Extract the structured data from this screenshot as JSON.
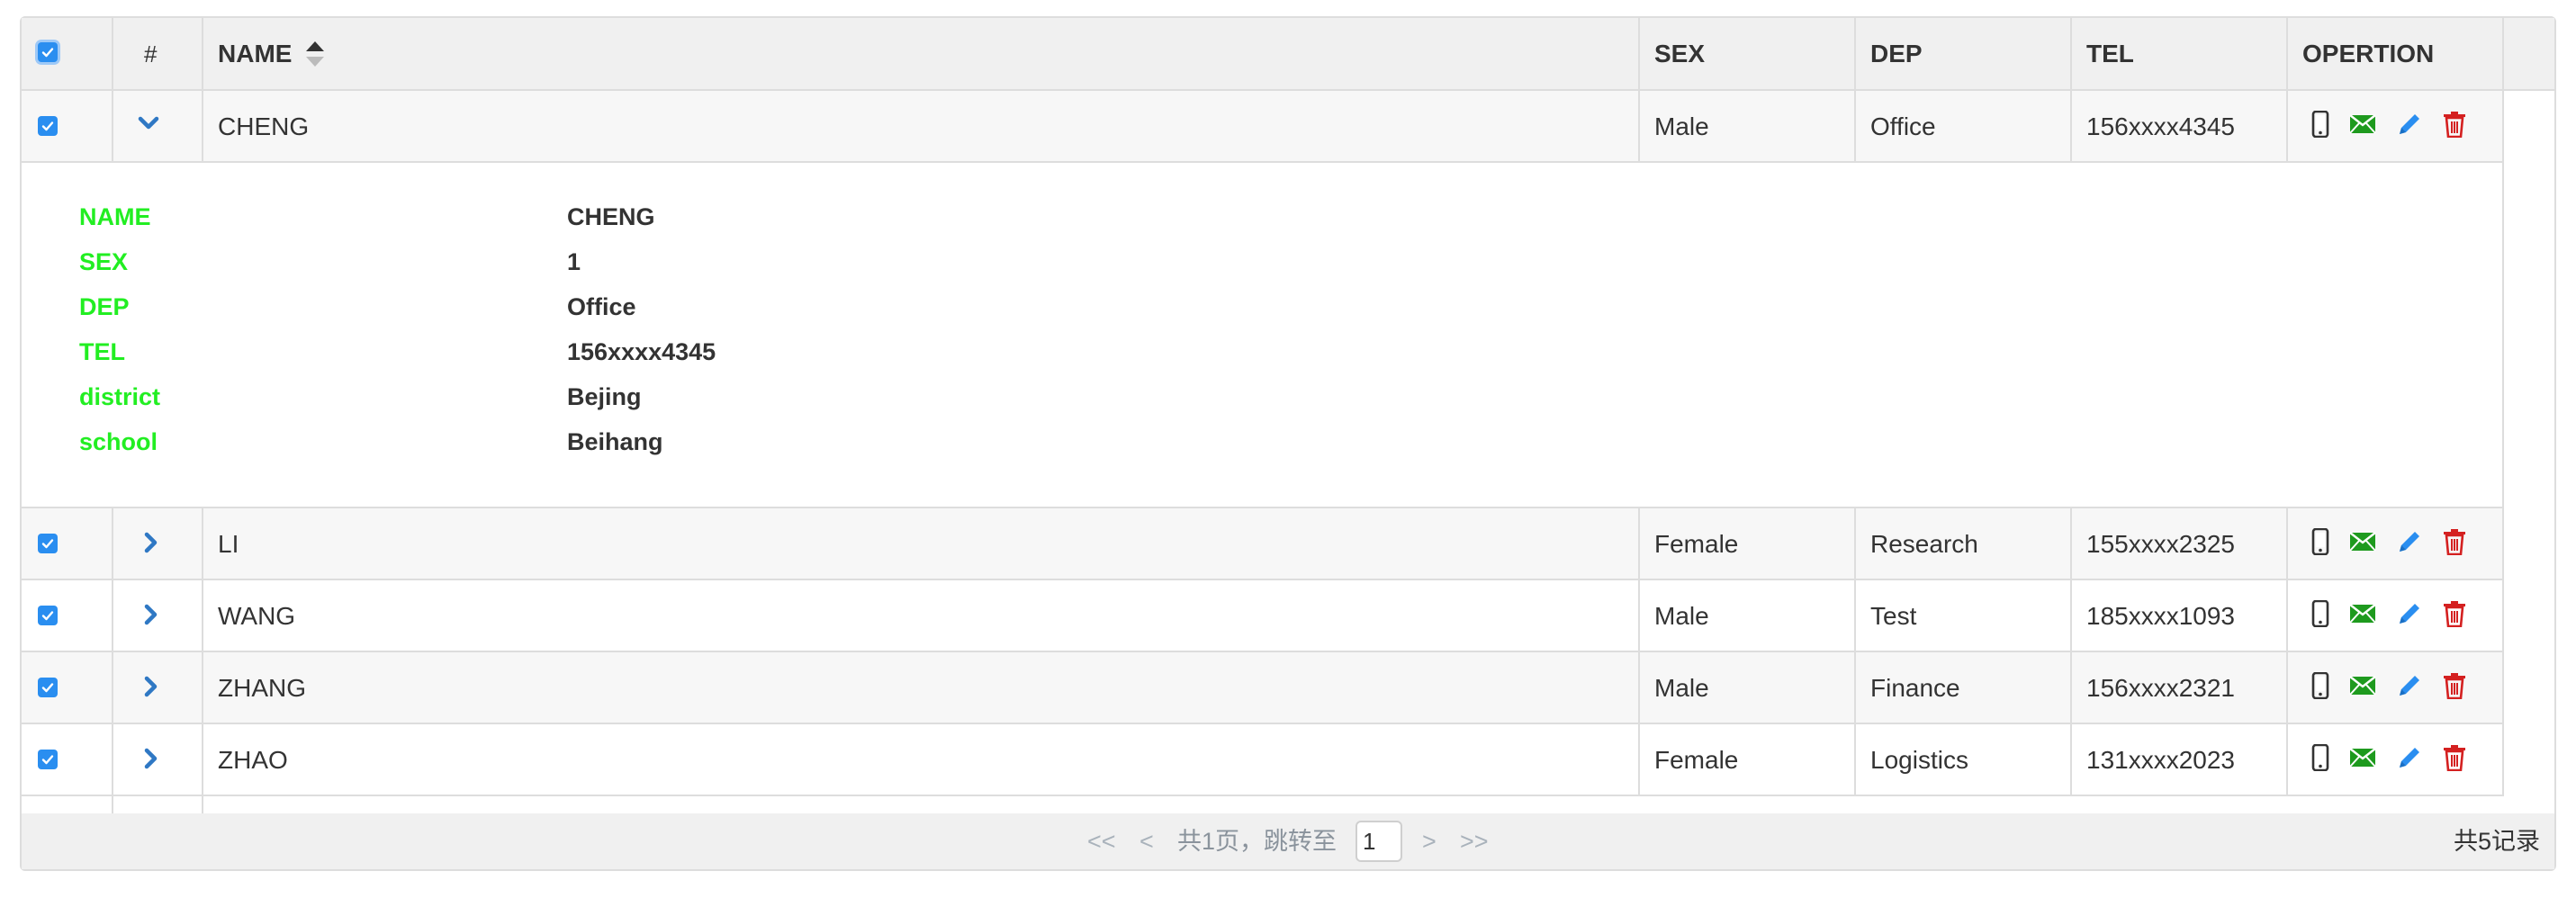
{
  "table": {
    "header": {
      "index": "#",
      "name": "NAME",
      "sex": "SEX",
      "dep": "DEP",
      "tel": "TEL",
      "operation": "OPERTION",
      "sort_icon": "sort-up-down-icon",
      "select_all_checked": true
    },
    "rows": [
      {
        "name": "CHENG",
        "sex": "Male",
        "dep": "Office",
        "tel": "156xxxx4345",
        "checked": true,
        "expanded": true
      },
      {
        "name": "LI",
        "sex": "Female",
        "dep": "Research",
        "tel": "155xxxx2325",
        "checked": true,
        "expanded": false
      },
      {
        "name": "WANG",
        "sex": "Male",
        "dep": "Test",
        "tel": "185xxxx1093",
        "checked": true,
        "expanded": false
      },
      {
        "name": "ZHANG",
        "sex": "Male",
        "dep": "Finance",
        "tel": "156xxxx2321",
        "checked": true,
        "expanded": false
      },
      {
        "name": "ZHAO",
        "sex": "Female",
        "dep": "Logistics",
        "tel": "131xxxx2023",
        "checked": true,
        "expanded": false
      }
    ],
    "detail": [
      {
        "label": "NAME",
        "value": "CHENG"
      },
      {
        "label": "SEX",
        "value": "1"
      },
      {
        "label": "DEP",
        "value": "Office"
      },
      {
        "label": "TEL",
        "value": "156xxxx4345"
      },
      {
        "label": "district",
        "value": "Bejing"
      },
      {
        "label": "school",
        "value": "Beihang"
      }
    ],
    "operation_icons": [
      "phone-icon",
      "mail-icon",
      "edit-icon",
      "delete-icon"
    ]
  },
  "pagination": {
    "first": "<<",
    "prev": "<",
    "info": "共1页，跳转至",
    "page_value": "1",
    "next": ">",
    "last": ">>",
    "total": "共5记录"
  },
  "colors": {
    "checkbox": "#2a8ef0",
    "chevron": "#2f78c4",
    "detail_label": "#22ee22",
    "phone": "#333333",
    "mail": "#1e9a1e",
    "edit": "#2a8ef0",
    "delete": "#d42020"
  }
}
